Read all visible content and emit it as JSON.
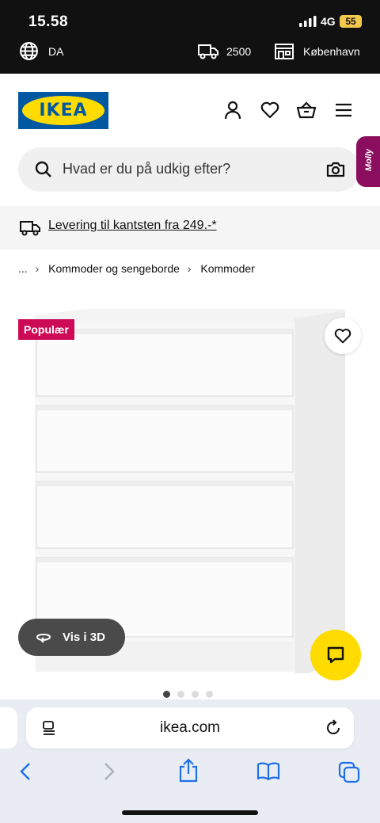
{
  "status_bar": {
    "time": "15.58",
    "network": "4G",
    "battery": "55",
    "language": "DA",
    "postal_code": "2500",
    "store": "København"
  },
  "header": {
    "logo_text": "IKEA",
    "brand_colors": {
      "blue": "#0058a3",
      "yellow": "#ffdb00"
    },
    "icons": [
      "user-icon",
      "heart-icon",
      "basket-icon",
      "menu-icon"
    ]
  },
  "search": {
    "placeholder": "Hvad er du på udkig efter?"
  },
  "assistant_tab": {
    "label": "Molly",
    "color": "#8b0d5e"
  },
  "delivery_banner": {
    "text": "Levering til kantsten fra 249.-*"
  },
  "breadcrumb": {
    "items": [
      "...",
      "Kommoder og sengeborde",
      "Kommoder"
    ]
  },
  "product": {
    "badge": "Populær",
    "badge_color": "#cc0a55",
    "view_3d_label": "Vis i 3D",
    "carousel": {
      "total": 4,
      "active": 1
    }
  },
  "browser": {
    "url": "ikea.com"
  }
}
